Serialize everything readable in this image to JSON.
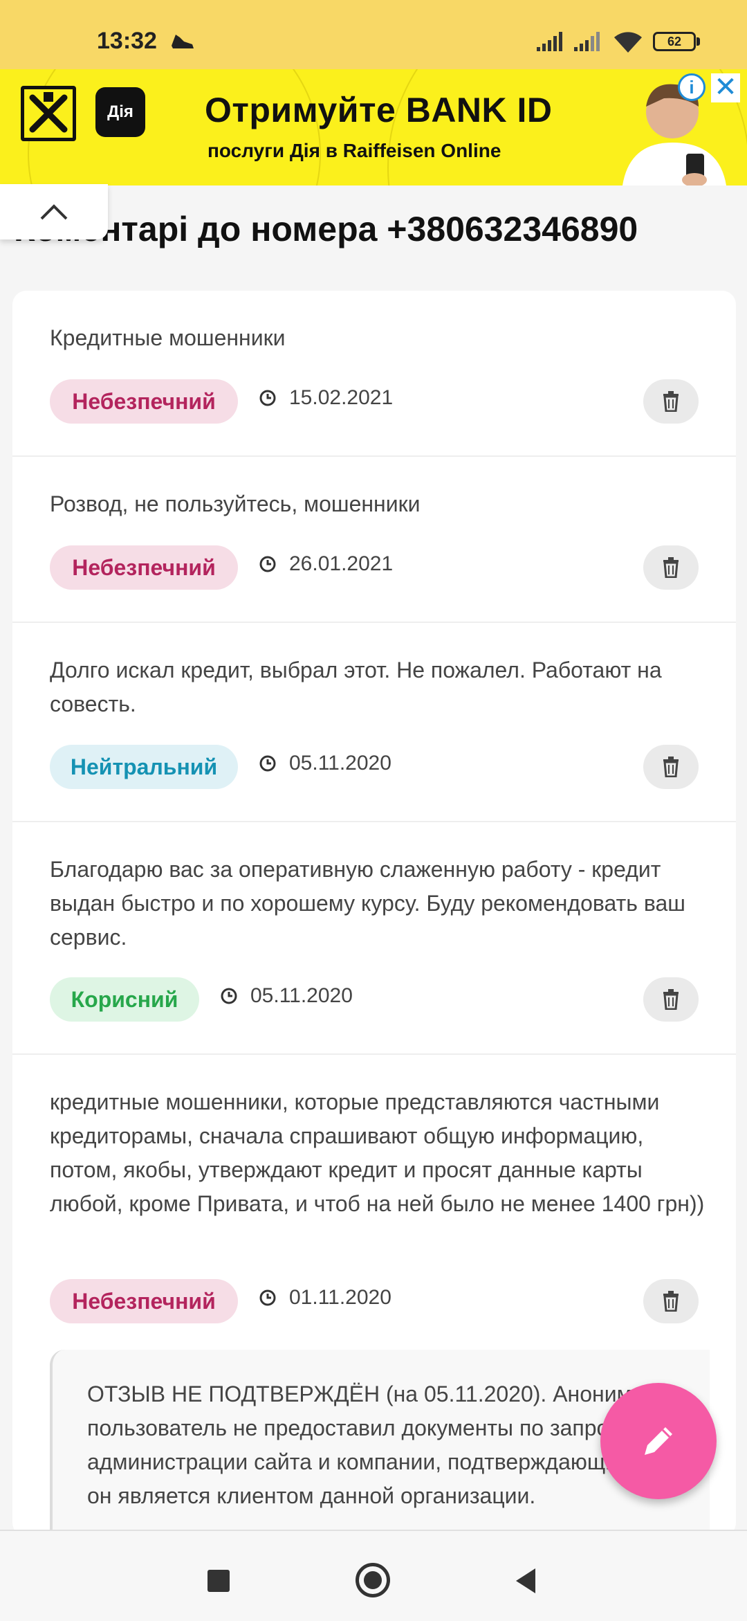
{
  "status_bar": {
    "time": "13:32",
    "battery": "62"
  },
  "ad": {
    "headline": "Отримуйте BANK ID",
    "subline": "послуги Дія в Raiffeisen Online",
    "diia_logo": "Дія"
  },
  "page": {
    "title": "Коментарі до номера +380632346890"
  },
  "comments": [
    {
      "text": "Кредитные мошенники",
      "badge": "Небезпечний",
      "date": "15.02.2021"
    },
    {
      "text": "Розвод, не пользуйтесь, мошенники",
      "badge": "Небезпечний",
      "date": "26.01.2021"
    },
    {
      "text": "Долго искал кредит, выбрал этот. Не пожалел. Работают на совесть.",
      "badge": "Нейтральний",
      "date": "05.11.2020"
    },
    {
      "text": "Благодарю вас за оперативную слаженную работу - кредит выдан быстро и по хорошему курсу. Буду рекомендовать ваш сервис.",
      "badge": "Корисний",
      "date": "05.11.2020"
    },
    {
      "text": "кредитные мошенники, которые представляются частными кредиторамы, сначала спрашивают общую информацию, потом, якобы, утверждают кредит и просят данные карты любой, кроме Привата, и чтоб на ней было не менее 1400 грн))",
      "badge": "Небезпечний",
      "date": "01.11.2020"
    }
  ],
  "admin_note": {
    "text": "ОТЗЫВ НЕ ПОДТВЕРЖДЁН (на 05.11.2020). Анонимный пользователь не предоставил документы по запросу администрации сайта и компании, подтверждающие, что он является клиентом данной организации."
  },
  "colors": {
    "status_bar": "#f8d866",
    "ad_background": "#fbf01c",
    "danger_badge_bg": "#f6dde6",
    "danger_badge_text": "#b3245d",
    "neutral_badge_bg": "#dff1f6",
    "neutral_badge_text": "#1592b3",
    "useful_badge_bg": "#def5e4",
    "useful_badge_text": "#27a74b",
    "fab": "#f55aa5"
  },
  "icons": {
    "collapse": "chevron-up-icon",
    "date": "clock-icon",
    "delete": "trash-icon",
    "fab": "pencil-icon",
    "ad_info": "info-icon",
    "ad_close": "close-icon"
  }
}
